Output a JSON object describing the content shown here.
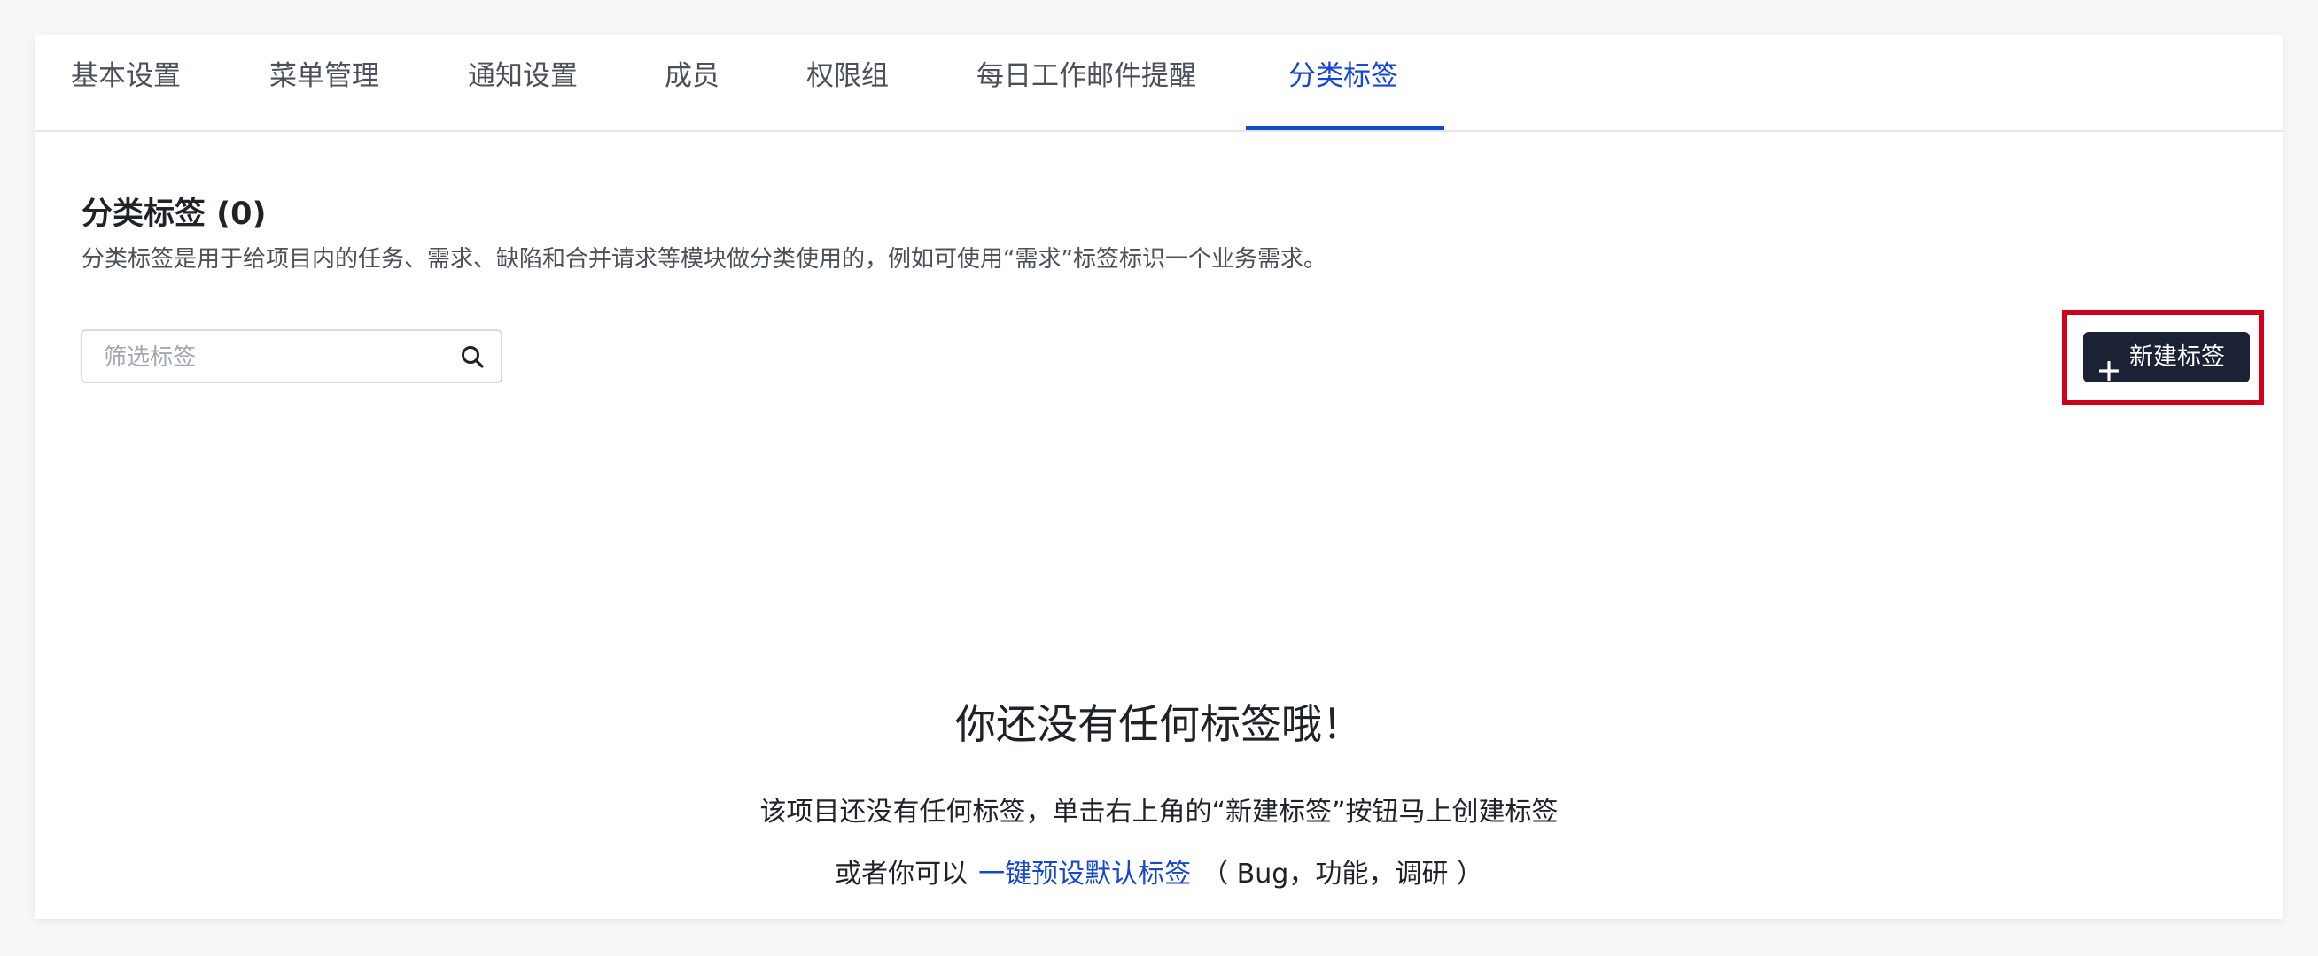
{
  "tabs": [
    {
      "label": "基本设置"
    },
    {
      "label": "菜单管理"
    },
    {
      "label": "通知设置"
    },
    {
      "label": "成员"
    },
    {
      "label": "权限组"
    },
    {
      "label": "每日工作邮件提醒"
    },
    {
      "label": "分类标签",
      "active": true
    }
  ],
  "section": {
    "title": "分类标签 (0)",
    "description": "分类标签是用于给项目内的任务、需求、缺陷和合并请求等模块做分类使用的，例如可使用“需求”标签标识一个业务需求。"
  },
  "filter": {
    "placeholder": "筛选标签",
    "value": "",
    "icon": "search-icon"
  },
  "new_button": {
    "label": "新建标签",
    "icon": "plus-icon"
  },
  "empty": {
    "title": "你还没有任何标签哦！",
    "description": "该项目还没有任何标签，单击右上角的“新建标签”按钮马上创建标签",
    "alt_prefix": "或者你可以",
    "alt_link": "一键预设默认标签",
    "alt_suffix": "（ Bug，功能，调研 ）"
  },
  "colors": {
    "accent": "#1547d1",
    "button_bg": "#1b2235",
    "highlight": "#d0021b"
  }
}
